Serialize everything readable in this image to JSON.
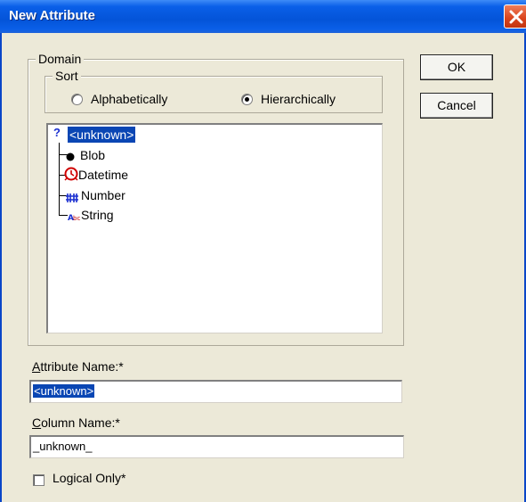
{
  "window": {
    "title": "New Attribute",
    "close_icon": "close-x-icon"
  },
  "domain": {
    "legend": "Domain",
    "sort": {
      "legend": "Sort",
      "options": [
        {
          "label": "Alphabetically",
          "checked": false
        },
        {
          "label": "Hierarchically",
          "checked": true
        }
      ]
    },
    "tree": {
      "root": {
        "icon": "question-mark-icon",
        "label": "<unknown>",
        "selected": true
      },
      "children": [
        {
          "icon": "filled-circle-icon",
          "label": "Blob"
        },
        {
          "icon": "clock-icon",
          "label": "Datetime"
        },
        {
          "icon": "number-hash-icon",
          "label": "Number"
        },
        {
          "icon": "abc-text-icon",
          "label": "String"
        }
      ]
    }
  },
  "buttons": {
    "ok": "OK",
    "cancel": "Cancel"
  },
  "attribute_name": {
    "label_prefix": "A",
    "label_rest": "ttribute Name:*",
    "value": "<unknown>"
  },
  "column_name": {
    "label_prefix": "C",
    "label_rest": "olumn Name:*",
    "value": "_unknown_"
  },
  "logical_only": {
    "label": "Logical Only*",
    "checked": false
  },
  "colors": {
    "titlebar": "#0454d8",
    "selection": "#0a46b4",
    "dialog_bg": "#ece9d8",
    "close_button": "#d9431c"
  }
}
